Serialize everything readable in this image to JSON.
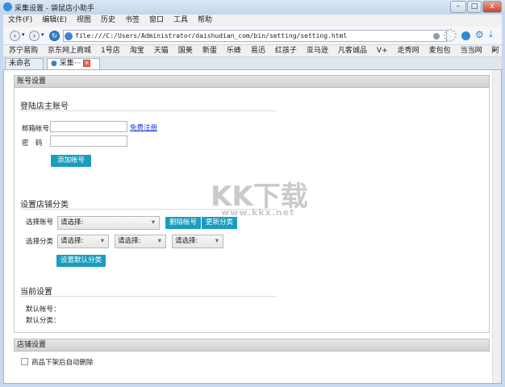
{
  "window": {
    "title": "采集设置 - 袋鼠店小助手",
    "min": "–",
    "max": "□",
    "close": "x"
  },
  "menu": [
    "文件(F)",
    "编辑(E)",
    "视图",
    "历史",
    "书签",
    "窗口",
    "工具",
    "帮助"
  ],
  "address": {
    "url": "file:///C:/Users/Administrator/daishudian_com/bin/setting/setting.html"
  },
  "bookmarks": [
    "苏宁易购",
    "京东网上商城",
    "1号店",
    "淘宝",
    "天猫",
    "国美",
    "新蛋",
    "乐蜂",
    "易迅",
    "红孩子",
    "亚马逊",
    "凡客诚品",
    "V+",
    "走秀网",
    "麦包包",
    "当当网",
    "阿里妈妈"
  ],
  "bookmarks_more": "»",
  "tabs": [
    {
      "label": "未命名"
    },
    {
      "label": "采集···"
    }
  ],
  "account_section": {
    "header": "账号设置",
    "login_title": "登陆店主账号",
    "email_label": "邮箱帐号",
    "password_label": "密　码",
    "register_link": "免费注册",
    "add_button": "添加帐号"
  },
  "category_section": {
    "title": "设置店铺分类",
    "select_account_label": "选择账号",
    "select_category_label": "选择分类",
    "placeholder": "请选择:",
    "delete_button": "删除帐号",
    "update_button": "更新分类",
    "set_default_button": "设置默认分类"
  },
  "current_section": {
    "title": "当前设置",
    "default_account": "默认帐号：",
    "default_category": "默认分类："
  },
  "shop_section": {
    "header": "店铺设置",
    "auto_delete": "商品下架后自动删除"
  },
  "watermark": {
    "logo": "KK下载",
    "url": "www.kkx.net"
  }
}
